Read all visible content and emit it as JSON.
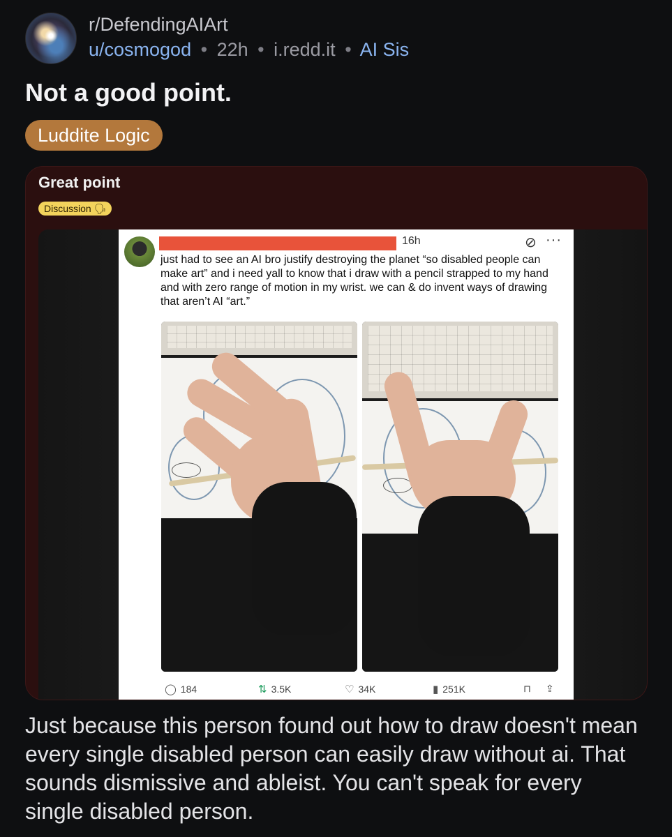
{
  "header": {
    "subreddit": "r/DefendingAIArt",
    "username": "u/cosmogod",
    "age": "22h",
    "domain": "i.redd.it",
    "user_flair": "AI Sis",
    "separator": "•"
  },
  "post": {
    "title": "Not a good point.",
    "flair": "Luddite Logic",
    "body": "Just because this person found out how to draw doesn't mean every single disabled person can easily draw without ai. That sounds dismissive and ableist. You can't speak for every single disabled person."
  },
  "embed": {
    "title": "Great point",
    "tag": "Discussion 🗣",
    "tweet": {
      "time": "16h",
      "text": "just had to see an AI bro justify destroying the planet “so disabled people can make art” and i need yall to know that i draw with a pencil strapped to my hand and with zero range of motion in my wrist. we can & do invent ways of drawing that aren’t AI “art.”",
      "replies": "184",
      "reposts": "3.5K",
      "likes": "34K",
      "views": "251K",
      "icons": [
        "reply-icon",
        "repost-icon",
        "like-icon",
        "views-icon",
        "bookmark-icon",
        "share-icon",
        "grok-icon",
        "more-icon"
      ]
    }
  },
  "colors": {
    "background": "#0e0f11",
    "flair": "#b3783c",
    "link": "#8ab4f0",
    "embed_bg": "#2b0f0f",
    "tag_bg": "#f3d35c",
    "redaction": "#e8533a"
  }
}
